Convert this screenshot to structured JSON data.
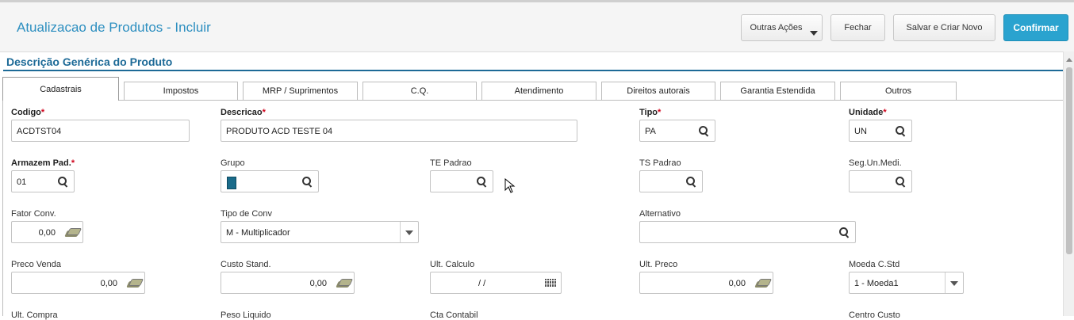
{
  "header": {
    "title": "Atualizacao de Produtos - Incluir",
    "buttons": {
      "outras_acoes": "Outras Ações",
      "fechar": "Fechar",
      "salvar_criar_novo": "Salvar e Criar Novo",
      "confirmar": "Confirmar"
    }
  },
  "section": {
    "title": "Descrição Genérica do Produto"
  },
  "tabs": [
    "Cadastrais",
    "Impostos",
    "MRP / Suprimentos",
    "C.Q.",
    "Atendimento",
    "Direitos autorais",
    "Garantia Estendida",
    "Outros"
  ],
  "active_tab": "Cadastrais",
  "required_marker": "*",
  "fields": {
    "codigo": {
      "label": "Codigo",
      "value": "ACDTST04"
    },
    "descricao": {
      "label": "Descricao",
      "value": "PRODUTO ACD TESTE 04"
    },
    "tipo": {
      "label": "Tipo",
      "value": "PA"
    },
    "unidade": {
      "label": "Unidade",
      "value": "UN"
    },
    "armazem": {
      "label": "Armazem Pad.",
      "value": "01"
    },
    "grupo": {
      "label": "Grupo",
      "value": ""
    },
    "te_padrao": {
      "label": "TE Padrao",
      "value": ""
    },
    "ts_padrao": {
      "label": "TS Padrao",
      "value": ""
    },
    "seg_un_medi": {
      "label": "Seg.Un.Medi.",
      "value": ""
    },
    "fator_conv": {
      "label": "Fator Conv.",
      "value": "0,00"
    },
    "tipo_conv": {
      "label": "Tipo de Conv",
      "value": "M - Multiplicador"
    },
    "alternativo": {
      "label": "Alternativo",
      "value": ""
    },
    "preco_venda": {
      "label": "Preco Venda",
      "value": "0,00"
    },
    "custo_stand": {
      "label": "Custo Stand.",
      "value": "0,00"
    },
    "ult_calculo": {
      "label": "Ult. Calculo",
      "value": "/ /"
    },
    "ult_preco": {
      "label": "Ult. Preco",
      "value": "0,00"
    },
    "moeda_cstd": {
      "label": "Moeda C.Std",
      "value": "1 - Moeda1"
    },
    "ult_compra": {
      "label": "Ult. Compra"
    },
    "peso_liquido": {
      "label": "Peso Liquido"
    },
    "cta_contabil": {
      "label": "Cta Contabil"
    },
    "centro_custo": {
      "label": "Centro Custo"
    }
  }
}
